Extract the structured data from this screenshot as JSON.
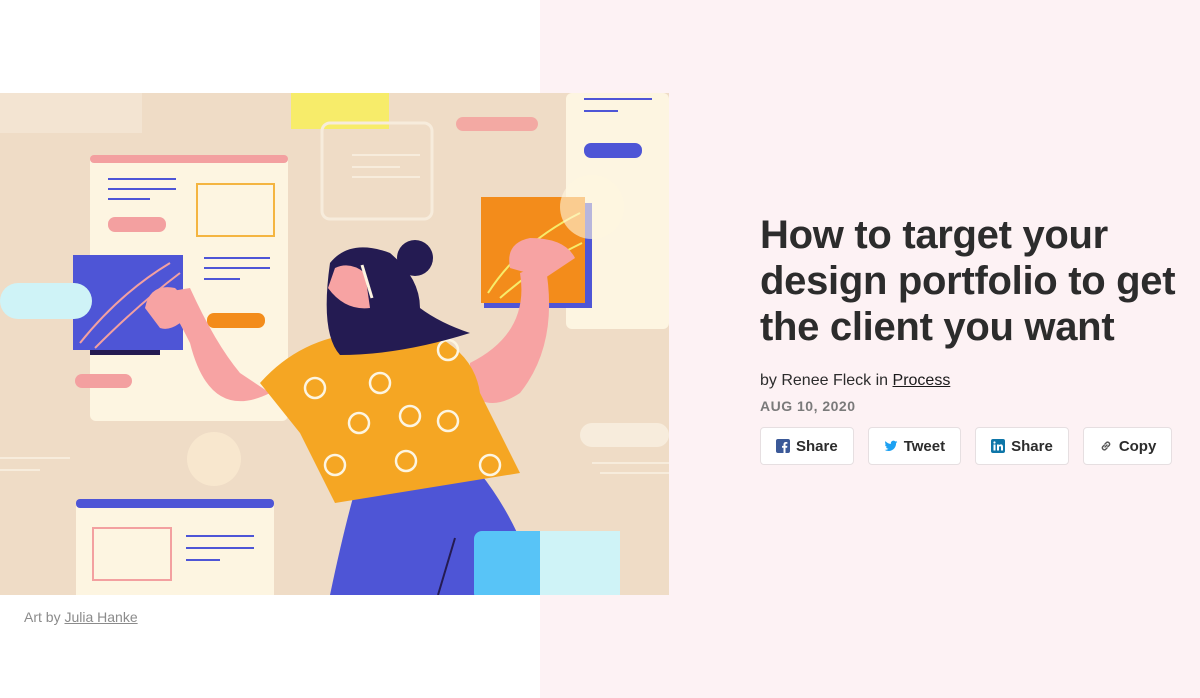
{
  "article": {
    "title": "How to target your design portfolio to get the client you want",
    "byline_prefix": "by Renee Fleck in",
    "category": "Process",
    "date": "AUG 10, 2020"
  },
  "caption": {
    "prefix": "Art by",
    "artist": "Julia Hanke"
  },
  "share": {
    "facebook_label": "Share",
    "twitter_label": "Tweet",
    "linkedin_label": "Share",
    "copy_label": "Copy"
  },
  "icons": {
    "facebook": "facebook-icon",
    "twitter": "twitter-icon",
    "linkedin": "linkedin-icon",
    "copy": "link-icon"
  },
  "colors": {
    "facebook": "#3b5998",
    "twitter": "#1da1f2",
    "linkedin": "#0e76a8",
    "panel": "#fdf2f4"
  }
}
